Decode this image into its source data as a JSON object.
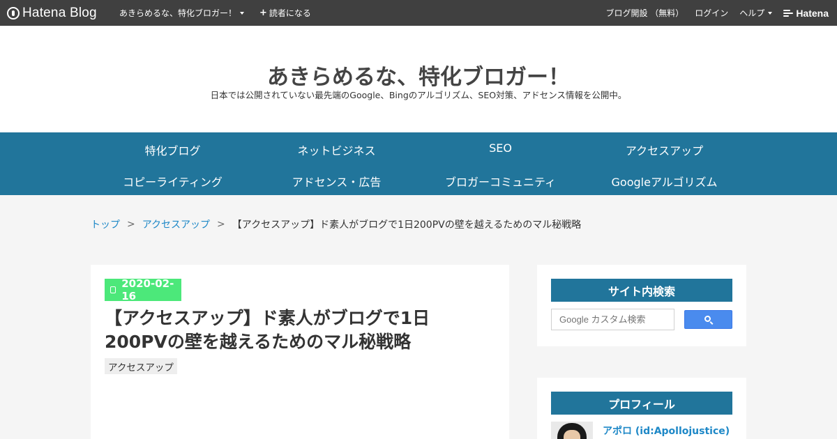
{
  "topbar": {
    "logo_text": "Hatena Blog",
    "blog_name": "あきらめるな、特化ブロガー！",
    "subscribe": "読者になる",
    "open_blog": "ブログ開設 （無料）",
    "login": "ログイン",
    "help": "ヘルプ",
    "hatena_logo": "Hatena"
  },
  "header": {
    "title": "あきらめるな、特化ブロガー！",
    "description": "日本では公開されていない最先端のGoogle、Bingのアルゴリズム、SEO対策、アドセンス情報を公開中。"
  },
  "nav": {
    "items": [
      {
        "label": "特化ブログ"
      },
      {
        "label": "ネットビジネス"
      },
      {
        "label": "SEO"
      },
      {
        "label": "アクセスアップ"
      },
      {
        "label": "コピーライティング"
      },
      {
        "label": "アドセンス・広告"
      },
      {
        "label": "ブロガーコミュニティ"
      },
      {
        "label": "Googleアルゴリズム"
      }
    ]
  },
  "breadcrumb": {
    "home": "トップ",
    "sep": ">",
    "category": "アクセスアップ",
    "current": "【アクセスアップ】ド素人がブログで1日200PVの壁を越えるためのマル秘戦略"
  },
  "article": {
    "date": "2020-02-16",
    "title_line1": "【アクセスアップ】ド素人がブログで1日",
    "title_line2": "200PVの壁を越えるためのマル秘戦略",
    "category": "アクセスアップ"
  },
  "sidebar": {
    "search": {
      "heading": "サイト内検索",
      "placeholder": "Google カスタム検索"
    },
    "profile": {
      "heading": "プロフィール",
      "name": "アポロ (id:Apollojustice)"
    }
  },
  "colors": {
    "topbar_bg": "#404040",
    "nav_bg": "#21759b",
    "date_badge": "#4ce87a",
    "link": "#1e88c7",
    "search_button": "#4a8bee"
  }
}
